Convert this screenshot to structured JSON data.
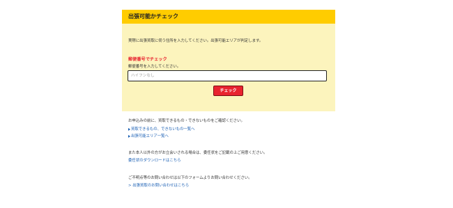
{
  "panel": {
    "title": "出張可能かチェック",
    "notice": "実際に出張買取に伺う住所を入力してください。出張可能エリアが判定します。",
    "zip_heading": "郵便番号でチェック",
    "zip_instruction": "郵便番号を入力してください。",
    "zip_placeholder": "ハイフンなし",
    "zip_value": "",
    "check_button": "チェック"
  },
  "info": {
    "confirm_text": "お申込みの前に、買取できるもの・できないものをご確認ください。",
    "link_items": "買取できるもの、できないもの一覧へ",
    "link_area": "出張可能エリア一覧へ",
    "proxy_text": "また本人以外の方がお立会いされる場合は、委任状をご記載の上ご用意ください。",
    "link_proxy": "委任状のダウンロードはこちら",
    "inquiry_text": "ご不明点等のお問い合わせは以下のフォームよりお問い合わせください。",
    "link_inquiry": "> 出張買取のお問い合わせはこちら"
  },
  "colors": {
    "header_bg": "#ffcc00",
    "panel_bg": "#fcf4bd",
    "accent_red": "#e8232f",
    "link_blue": "#1a5fb4"
  }
}
